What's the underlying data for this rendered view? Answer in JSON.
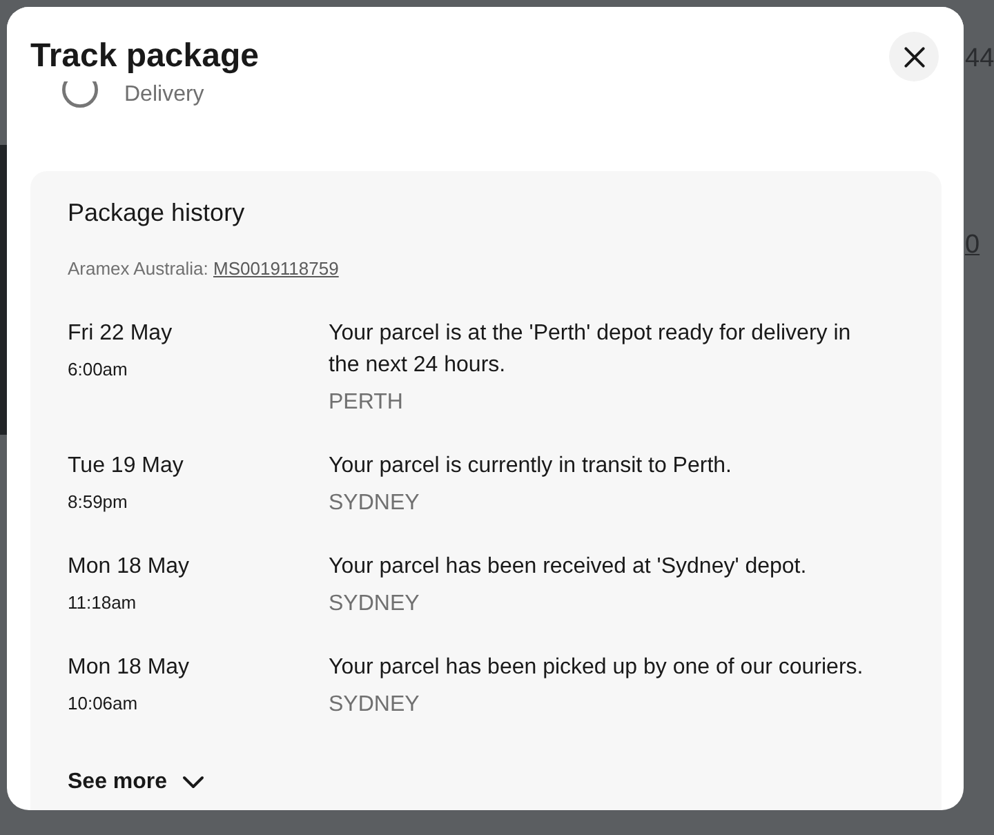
{
  "background": {
    "fragments": [
      {
        "kind": "text",
        "text": "44"
      },
      {
        "kind": "link",
        "text": "0"
      }
    ]
  },
  "dialog": {
    "title": "Track package"
  },
  "steps": [
    {
      "label": "Delivery",
      "completed": false
    }
  ],
  "history": {
    "title": "Package history",
    "carrier": "Aramex Australia:",
    "tracking_number": "MS0019118759",
    "events": [
      {
        "date": "Fri 22 May",
        "time": "6:00am",
        "description": "Your parcel is at the 'Perth' depot ready for delivery in the next 24 hours.",
        "location": "PERTH"
      },
      {
        "date": "Tue 19 May",
        "time": "8:59pm",
        "description": "Your parcel is currently in transit to Perth.",
        "location": "SYDNEY"
      },
      {
        "date": "Mon 18 May",
        "time": "11:18am",
        "description": "Your parcel has been received at 'Sydney' depot.",
        "location": "SYDNEY"
      },
      {
        "date": "Mon 18 May",
        "time": "10:06am",
        "description": "Your parcel has been picked up by one of our couriers.",
        "location": "SYDNEY"
      }
    ],
    "see_more": {
      "label": "See more",
      "expanded": false
    }
  }
}
